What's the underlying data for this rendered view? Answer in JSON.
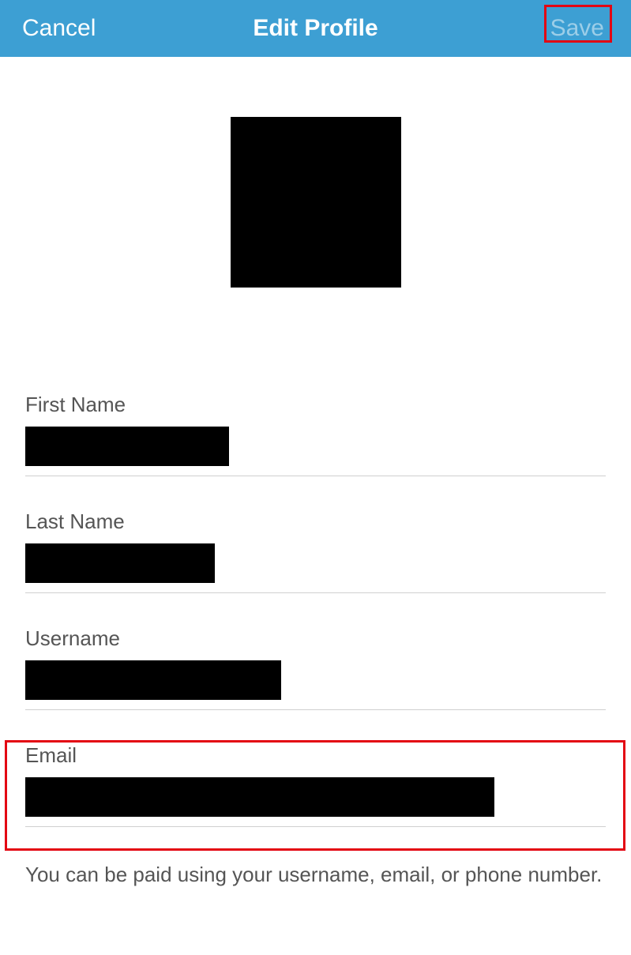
{
  "header": {
    "cancel_label": "Cancel",
    "title": "Edit Profile",
    "save_label": "Save"
  },
  "form": {
    "first_name_label": "First Name",
    "last_name_label": "Last Name",
    "username_label": "Username",
    "email_label": "Email"
  },
  "help_text": "You can be paid using your username, email, or phone number."
}
